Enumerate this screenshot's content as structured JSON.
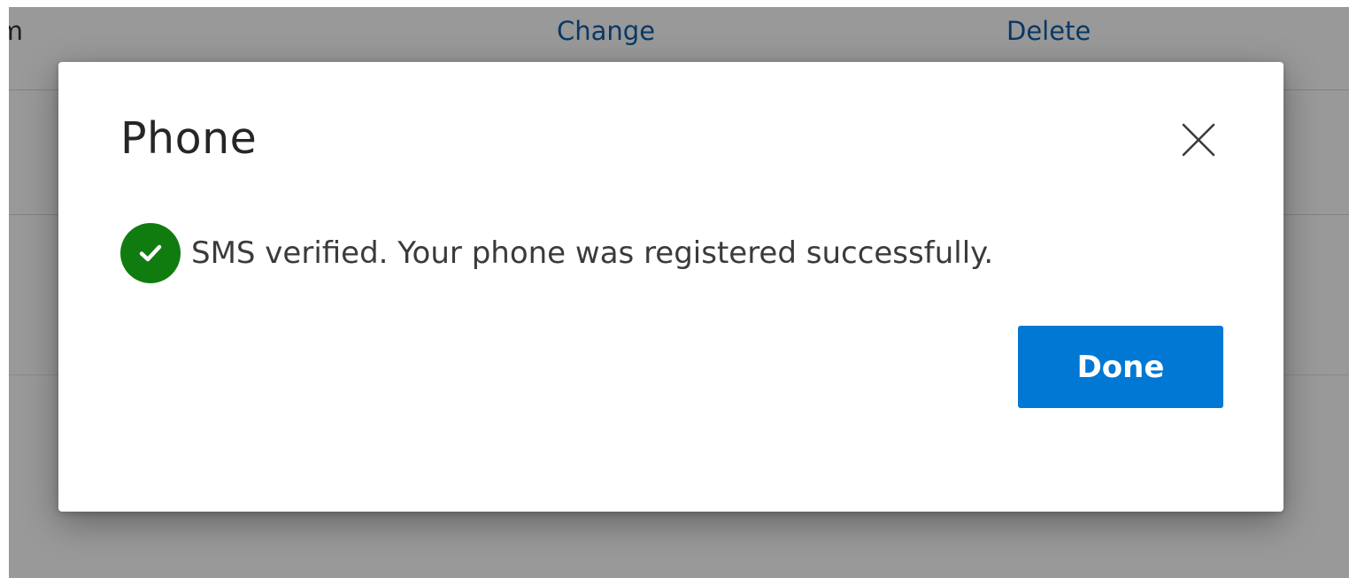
{
  "background": {
    "clipped_text": "om",
    "change_link": "Change",
    "delete_link": "Delete"
  },
  "dialog": {
    "title": "Phone",
    "close_icon": "close-icon",
    "status_icon": "checkmark-circle-icon",
    "message": "SMS verified. Your phone was registered successfully.",
    "done_label": "Done"
  },
  "colors": {
    "accent": "#0078d4",
    "success": "#107c10",
    "link": "#0f5ea8",
    "overlay": "rgba(0,0,0,0.40)"
  }
}
